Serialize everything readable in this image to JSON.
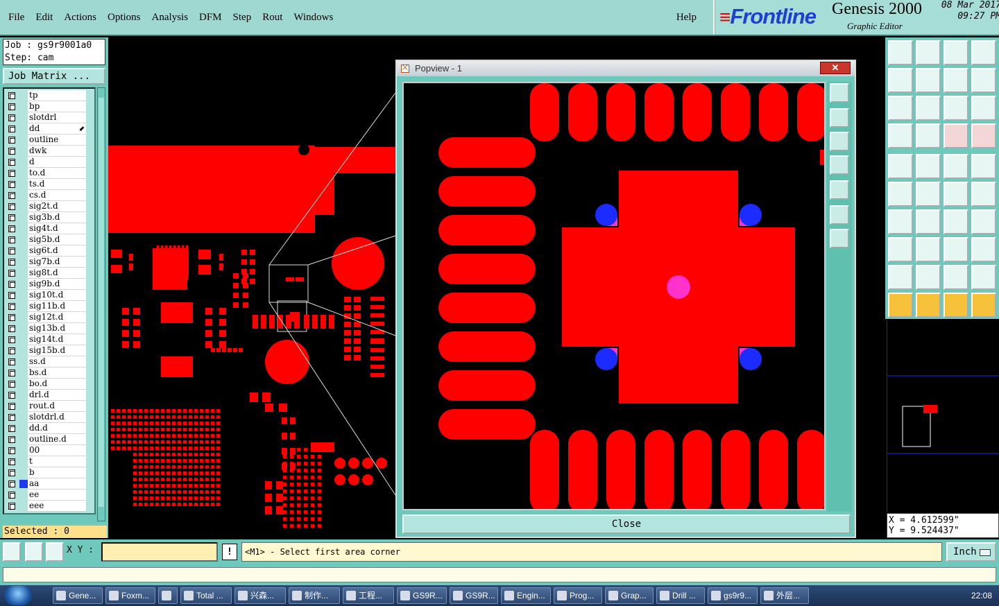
{
  "menubar": {
    "items": [
      "File",
      "Edit",
      "Actions",
      "Options",
      "Analysis",
      "DFM",
      "Step",
      "Rout",
      "Windows"
    ],
    "help": "Help"
  },
  "brand": {
    "logo": "Frontline",
    "product": "Genesis 2000",
    "subtitle": "Graphic Editor",
    "date": "08 Mar 2017",
    "time": "09:27 PM"
  },
  "job": {
    "job_line": "Job : gs9r9001a0",
    "step_line": "Step: cam",
    "matrix_button": "Job Matrix ..."
  },
  "layers": [
    "tp",
    "bp",
    "slotdrl",
    "dd",
    "outline",
    "dwk",
    "d",
    "to.d",
    "ts.d",
    "cs.d",
    "sig2t.d",
    "sig3b.d",
    "sig4t.d",
    "sig5b.d",
    "sig6t.d",
    "sig7b.d",
    "sig8t.d",
    "sig9b.d",
    "sig10t.d",
    "sig11b.d",
    "sig12t.d",
    "sig13b.d",
    "sig14t.d",
    "sig15b.d",
    "ss.d",
    "bs.d",
    "bo.d",
    "drl.d",
    "rout.d",
    "slotdrl.d",
    "dd.d",
    "outline.d",
    "00",
    "t",
    "b",
    "aa",
    "ee",
    "eee"
  ],
  "layer_marks": {
    "dd": "⬋",
    "to.d": "⬋",
    "bo.d": "⬋",
    "dd.d": "⬋"
  },
  "active_layer": "aa",
  "selected": "Selected : 0",
  "popview": {
    "title": "Popview - 1",
    "close_x": "✕",
    "close_button": "Close"
  },
  "coords": {
    "x": "X = 4.612599\"",
    "y": "Y = 9.524437\""
  },
  "command": {
    "xy_label": "X Y :",
    "xy_value": "",
    "warn": "!",
    "prompt": "<M1> - Select first area corner",
    "unit": "Inch"
  },
  "taskbar": {
    "items": [
      "Gene...",
      "Foxm...",
      "",
      "Total ...",
      "兴森...",
      "制作...",
      "工程...",
      "GS9R...",
      "GS9R...",
      "Engin...",
      "Prog...",
      "Grap...",
      "Drill ...",
      "gs9r9...",
      "外层..."
    ],
    "clock": "22:08"
  },
  "colors": {
    "pad": "#ff0000",
    "via": "#1c2bff",
    "hole": "#ff33cc",
    "panel": "#6ec8bb"
  }
}
